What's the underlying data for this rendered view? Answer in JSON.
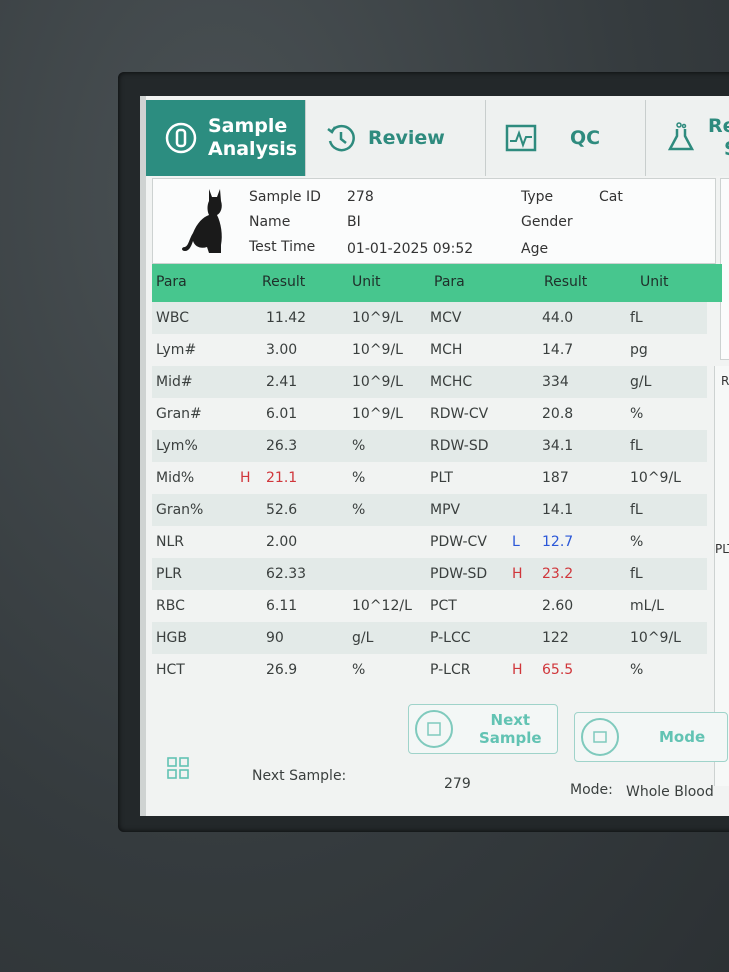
{
  "tabs": [
    {
      "label_line1": "Sample",
      "label_line2": "Analysis",
      "icon": "sample-analysis-icon",
      "active": true
    },
    {
      "label_line1": "Review",
      "label_line2": "",
      "icon": "review-icon",
      "active": false
    },
    {
      "label_line1": "QC",
      "label_line2": "",
      "icon": "qc-icon",
      "active": false
    },
    {
      "label_line1": "Re",
      "label_line2": "S",
      "icon": "reagent-icon",
      "active": false
    }
  ],
  "info": {
    "sample_id_label": "Sample ID",
    "sample_id": "278",
    "name_label": "Name",
    "name": "BI",
    "test_time_label": "Test Time",
    "test_time": "01-01-2025 09:52",
    "type_label": "Type",
    "type": "Cat",
    "gender_label": "Gender",
    "gender": "",
    "age_label": "Age",
    "age": ""
  },
  "table": {
    "headers": [
      "Para",
      "Result",
      "Unit",
      "Para",
      "Result",
      "Unit"
    ],
    "left": [
      {
        "para": "WBC",
        "flag": "",
        "result": "11.42",
        "unit": "10^9/L"
      },
      {
        "para": "Lym#",
        "flag": "",
        "result": "3.00",
        "unit": "10^9/L"
      },
      {
        "para": "Mid#",
        "flag": "",
        "result": "2.41",
        "unit": "10^9/L"
      },
      {
        "para": "Gran#",
        "flag": "",
        "result": "6.01",
        "unit": "10^9/L"
      },
      {
        "para": "Lym%",
        "flag": "",
        "result": "26.3",
        "unit": "%"
      },
      {
        "para": "Mid%",
        "flag": "H",
        "result": "21.1",
        "unit": "%"
      },
      {
        "para": "Gran%",
        "flag": "",
        "result": "52.6",
        "unit": "%"
      },
      {
        "para": "NLR",
        "flag": "",
        "result": "2.00",
        "unit": ""
      },
      {
        "para": "PLR",
        "flag": "",
        "result": "62.33",
        "unit": ""
      },
      {
        "para": "RBC",
        "flag": "",
        "result": "6.11",
        "unit": "10^12/L"
      },
      {
        "para": "HGB",
        "flag": "",
        "result": "90",
        "unit": "g/L"
      },
      {
        "para": "HCT",
        "flag": "",
        "result": "26.9",
        "unit": "%"
      }
    ],
    "right": [
      {
        "para": "MCV",
        "flag": "",
        "result": "44.0",
        "unit": "fL"
      },
      {
        "para": "MCH",
        "flag": "",
        "result": "14.7",
        "unit": "pg"
      },
      {
        "para": "MCHC",
        "flag": "",
        "result": "334",
        "unit": "g/L"
      },
      {
        "para": "RDW-CV",
        "flag": "",
        "result": "20.8",
        "unit": "%"
      },
      {
        "para": "RDW-SD",
        "flag": "",
        "result": "34.1",
        "unit": "fL"
      },
      {
        "para": "PLT",
        "flag": "",
        "result": "187",
        "unit": "10^9/L"
      },
      {
        "para": "MPV",
        "flag": "",
        "result": "14.1",
        "unit": "fL"
      },
      {
        "para": "PDW-CV",
        "flag": "L",
        "result": "12.7",
        "unit": "%"
      },
      {
        "para": "PDW-SD",
        "flag": "H",
        "result": "23.2",
        "unit": "fL"
      },
      {
        "para": "PCT",
        "flag": "",
        "result": "2.60",
        "unit": "mL/L"
      },
      {
        "para": "P-LCC",
        "flag": "",
        "result": "122",
        "unit": "10^9/L"
      },
      {
        "para": "P-LCR",
        "flag": "H",
        "result": "65.5",
        "unit": "%"
      }
    ]
  },
  "side": {
    "re_label": "RE",
    "plt_label": "PLT"
  },
  "buttons": {
    "next_sample_line1": "Next",
    "next_sample_line2": "Sample",
    "mode": "Mode"
  },
  "status": {
    "next_sample_label": "Next Sample:",
    "next_sample_value": "279",
    "mode_label": "Mode:",
    "mode_value": "Whole Blood"
  },
  "colors": {
    "accent": "#2c8d80",
    "header_green": "#47c68e",
    "flag_high": "#d0363b",
    "flag_low": "#2b57d8"
  }
}
